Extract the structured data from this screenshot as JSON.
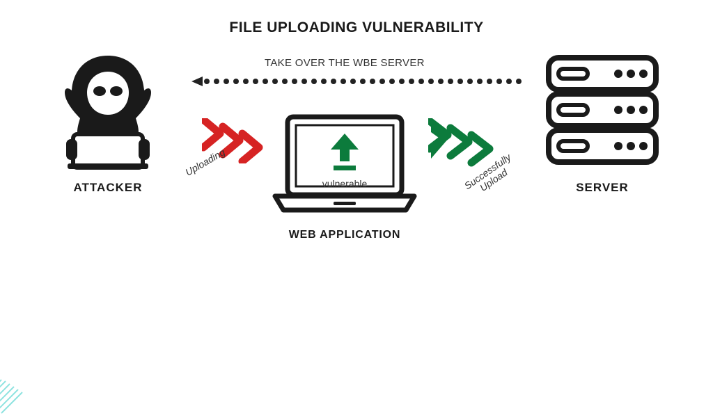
{
  "title": "FILE UPLOADING VULNERABILITY",
  "nodes": {
    "attacker": {
      "label": "ATTACKER"
    },
    "webapp": {
      "label": "WEB APPLICATION",
      "status": "vulnerable"
    },
    "server": {
      "label": "SERVER"
    }
  },
  "flows": {
    "takeover": {
      "label": "TAKE OVER THE WBE SERVER",
      "direction": "server_to_attacker",
      "style": "dotted-arrow"
    },
    "upload_step1": {
      "label": "Uploading",
      "direction": "attacker_to_webapp",
      "color": "#d62323"
    },
    "upload_step2": {
      "label": "Successfully Upload",
      "direction": "webapp_to_server",
      "color": "#0c7b3c"
    }
  },
  "icons": {
    "attacker": "hooded-hacker-laptop",
    "webapp": "laptop-upload",
    "server": "server-rack",
    "upload": "upload-arrow"
  },
  "colors": {
    "red": "#d62323",
    "green": "#0c7b3c",
    "black": "#1a1a1a"
  }
}
